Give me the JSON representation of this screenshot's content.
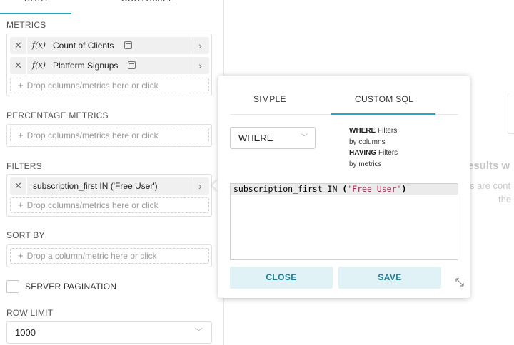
{
  "tabs": {
    "data": "DATA",
    "customize": "CUSTOMIZE"
  },
  "metrics": {
    "label": "METRICS",
    "items": [
      {
        "label": "Count of Clients",
        "icon": "function-icon"
      },
      {
        "label": "Platform Signups",
        "icon": "function-icon"
      }
    ],
    "drop_placeholder": "Drop columns/metrics here or click"
  },
  "percentage_metrics": {
    "label": "PERCENTAGE METRICS",
    "drop_placeholder": "Drop columns/metrics here or click"
  },
  "filters": {
    "label": "FILTERS",
    "items": [
      {
        "label": "subscription_first IN ('Free User')"
      }
    ],
    "drop_placeholder": "Drop columns/metrics here or click"
  },
  "sort_by": {
    "label": "SORT BY",
    "drop_placeholder": "Drop a column/metric here or click"
  },
  "server_pagination": {
    "label": "SERVER PAGINATION",
    "checked": false
  },
  "row_limit": {
    "label": "ROW LIMIT",
    "value": "1000"
  },
  "popover": {
    "tabs": {
      "simple": "SIMPLE",
      "custom_sql": "CUSTOM SQL",
      "active": "CUSTOM SQL"
    },
    "clause": {
      "value": "WHERE"
    },
    "help": {
      "where_kw": "WHERE",
      "where_rest": "Filters",
      "where_line2": "by columns",
      "having_kw": "HAVING",
      "having_rest": "Filters",
      "having_line2": "by metrics"
    },
    "sql": {
      "pre": "subscription_first IN ",
      "open": "(",
      "string": "'Free User'",
      "close": ")"
    },
    "close_label": "CLOSE",
    "save_label": "SAVE"
  },
  "background": {
    "line1": "esults w",
    "line2": "s are cont",
    "line3": "the"
  },
  "colors": {
    "accent": "#20a7c9",
    "button_bg": "#e1f2f7",
    "button_text": "#1c7f9a",
    "sql_string": "#b0204f"
  }
}
